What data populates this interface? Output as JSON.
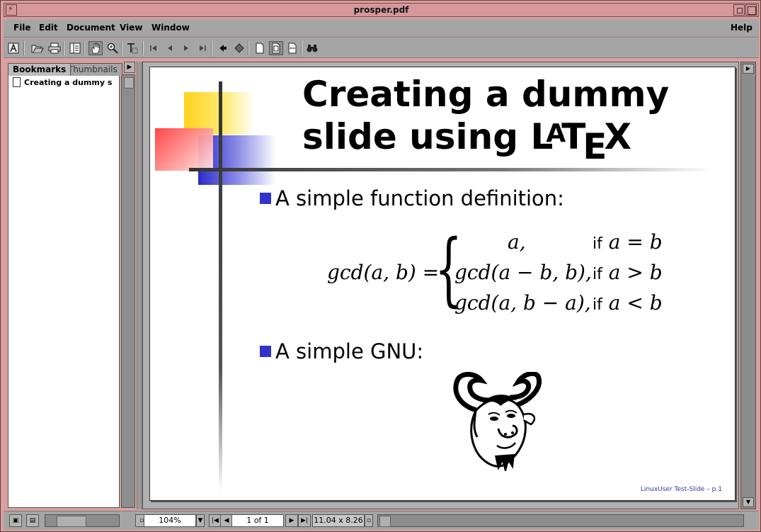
{
  "window": {
    "title": "prosper.pdf"
  },
  "menubar": {
    "file": "File",
    "edit": "Edit",
    "document": "Document",
    "view": "View",
    "window": "Window",
    "help": "Help"
  },
  "sidebar": {
    "tabs": {
      "bookmarks": "Bookmarks",
      "thumbnails": "Thumbnails"
    },
    "bookmarks": [
      {
        "label": "Creating a dummy s"
      }
    ]
  },
  "slide": {
    "title_line1": "Creating a dummy",
    "title_line2_prefix": "slide using ",
    "latex_L": "L",
    "latex_A": "A",
    "latex_T": "T",
    "latex_E": "E",
    "latex_X": "X",
    "bullet1": "A simple function definition:",
    "bullet2": "A simple GNU:",
    "math": {
      "lhs": "gcd(a, b) =",
      "cases": [
        {
          "value": "a,",
          "cond_word": "if",
          "cond": "a = b"
        },
        {
          "value": "gcd(a − b, b),",
          "cond_word": "if",
          "cond": "a > b"
        },
        {
          "value": "gcd(a, b − a),",
          "cond_word": "if",
          "cond": "a < b"
        }
      ]
    },
    "footer": "LinuxUser Test-Slide – p.1"
  },
  "statusbar": {
    "zoom": "104%",
    "page": "1 of 1",
    "page_size": "11.04 x 8.26"
  },
  "colors": {
    "frame": "#d9a0a0",
    "chrome": "#a5a5a5",
    "bullet_square": "#3333cc",
    "footer_text": "#3333aa"
  }
}
